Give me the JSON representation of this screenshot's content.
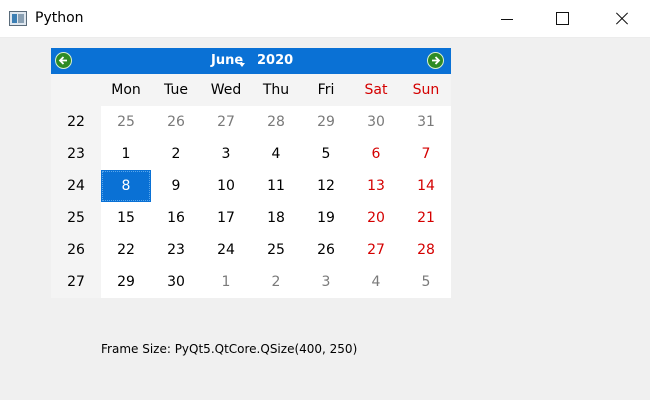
{
  "window": {
    "title": "Python"
  },
  "calendar": {
    "month": "June",
    "year": "2020",
    "day_headers": [
      "Mon",
      "Tue",
      "Wed",
      "Thu",
      "Fri",
      "Sat",
      "Sun"
    ],
    "weeks": [
      {
        "week": "22",
        "days": [
          {
            "d": "25",
            "cur": false
          },
          {
            "d": "26",
            "cur": false
          },
          {
            "d": "27",
            "cur": false
          },
          {
            "d": "28",
            "cur": false
          },
          {
            "d": "29",
            "cur": false
          },
          {
            "d": "30",
            "cur": false
          },
          {
            "d": "31",
            "cur": false
          }
        ]
      },
      {
        "week": "23",
        "days": [
          {
            "d": "1",
            "cur": true
          },
          {
            "d": "2",
            "cur": true
          },
          {
            "d": "3",
            "cur": true
          },
          {
            "d": "4",
            "cur": true
          },
          {
            "d": "5",
            "cur": true
          },
          {
            "d": "6",
            "cur": true
          },
          {
            "d": "7",
            "cur": true
          }
        ]
      },
      {
        "week": "24",
        "days": [
          {
            "d": "8",
            "cur": true,
            "selected": true
          },
          {
            "d": "9",
            "cur": true
          },
          {
            "d": "10",
            "cur": true
          },
          {
            "d": "11",
            "cur": true
          },
          {
            "d": "12",
            "cur": true
          },
          {
            "d": "13",
            "cur": true
          },
          {
            "d": "14",
            "cur": true
          }
        ]
      },
      {
        "week": "25",
        "days": [
          {
            "d": "15",
            "cur": true
          },
          {
            "d": "16",
            "cur": true
          },
          {
            "d": "17",
            "cur": true
          },
          {
            "d": "18",
            "cur": true
          },
          {
            "d": "19",
            "cur": true
          },
          {
            "d": "20",
            "cur": true
          },
          {
            "d": "21",
            "cur": true
          }
        ]
      },
      {
        "week": "26",
        "days": [
          {
            "d": "22",
            "cur": true
          },
          {
            "d": "23",
            "cur": true
          },
          {
            "d": "24",
            "cur": true
          },
          {
            "d": "25",
            "cur": true
          },
          {
            "d": "26",
            "cur": true
          },
          {
            "d": "27",
            "cur": true
          },
          {
            "d": "28",
            "cur": true
          }
        ]
      },
      {
        "week": "27",
        "days": [
          {
            "d": "29",
            "cur": true
          },
          {
            "d": "30",
            "cur": true
          },
          {
            "d": "1",
            "cur": false
          },
          {
            "d": "2",
            "cur": false
          },
          {
            "d": "3",
            "cur": false
          },
          {
            "d": "4",
            "cur": false
          },
          {
            "d": "5",
            "cur": false
          }
        ]
      }
    ],
    "colors": {
      "accent": "#0a71d5",
      "weekend": "#d40000",
      "nav_button": "#2e8b24"
    }
  },
  "frame_label": "Frame Size: PyQt5.QtCore.QSize(400, 250)"
}
